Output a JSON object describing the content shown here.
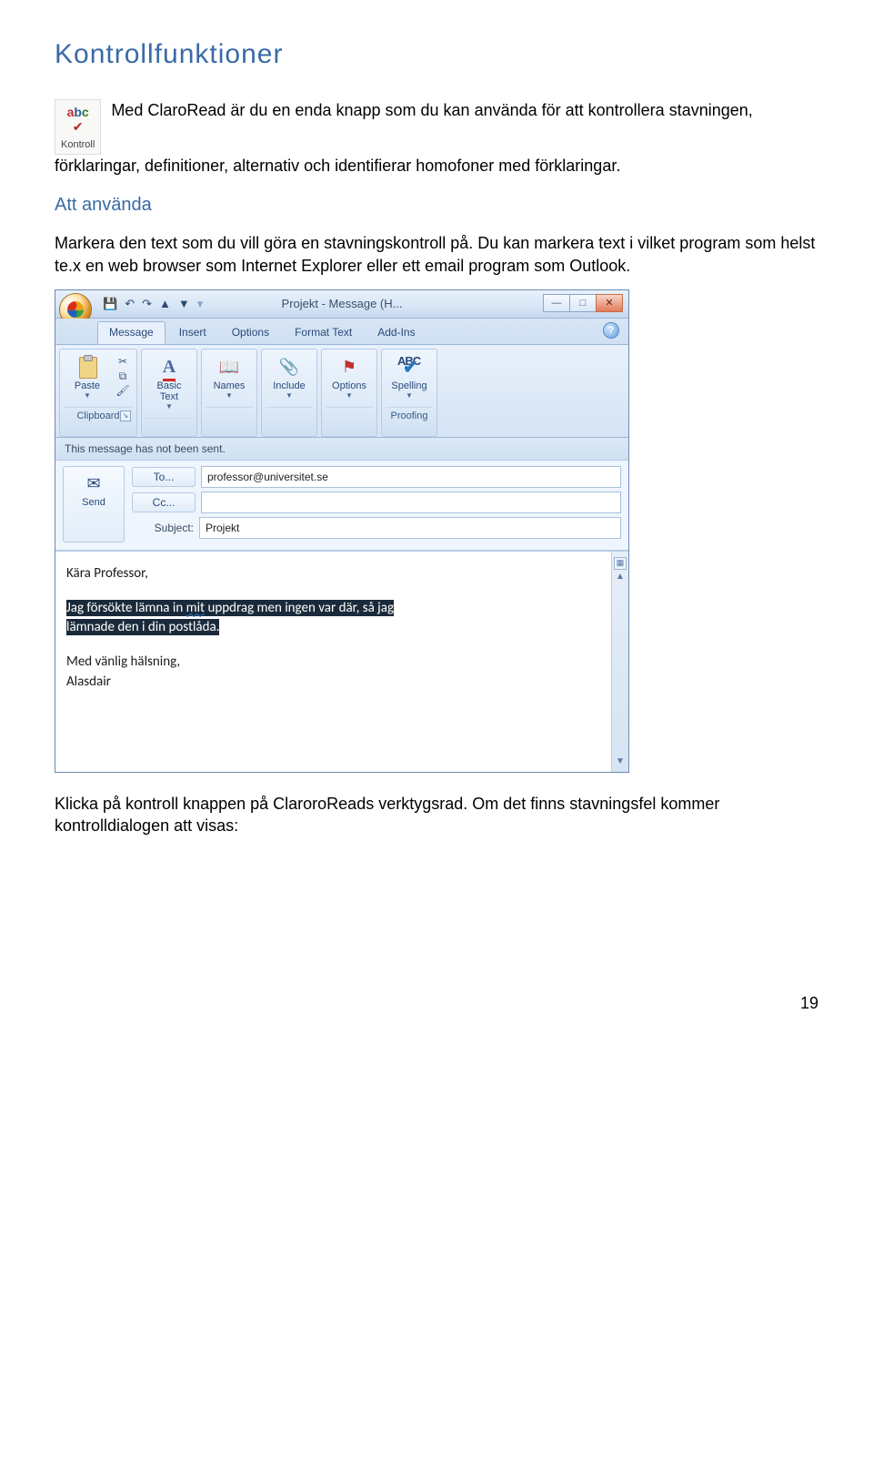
{
  "page": {
    "title": "Kontrollfunktioner",
    "kontroll_icon_label": "Kontroll",
    "intro_text": "Med ClaroRead är du en enda knapp som du kan använda för att kontrollera stavningen, förklaringar, definitioner, alternativ och identifierar homofoner med förklaringar.",
    "sub_heading": "Att använda",
    "para1": "Markera den text som du vill göra en stavningskontroll på. Du kan markera text i vilket program som helst te.x en web browser som Internet Explorer eller ett email program som Outlook.",
    "para2": "Klicka på kontroll knappen på ClaroroReads verktygsrad. Om det finns stavningsfel kommer kontrolldialogen att visas:",
    "page_number": "19"
  },
  "outlook": {
    "qat": {
      "save": "💾",
      "undo": "↶",
      "redo": "↷",
      "up": "▲",
      "down": "▼"
    },
    "window_title": "Projekt - Message (H...",
    "tabs": {
      "message": "Message",
      "insert": "Insert",
      "options": "Options",
      "format_text": "Format Text",
      "addins": "Add-Ins"
    },
    "ribbon": {
      "paste": "Paste",
      "clipboard": "Clipboard",
      "basic_text": "Basic\nText",
      "names": "Names",
      "include": "Include",
      "options": "Options",
      "spelling": "Spelling",
      "proofing": "Proofing",
      "abc": "ABC"
    },
    "infobar": "This message has not been sent.",
    "fields": {
      "send": "Send",
      "to_btn": "To...",
      "to_val": "professor@universitet.se",
      "cc_btn": "Cc...",
      "cc_val": "",
      "subject_lbl": "Subject:",
      "subject_val": "Projekt"
    },
    "body": {
      "greeting": "Kära Professor,",
      "sel_line1_a": "Jag försökte lämna in ",
      "sel_line1_b": "mit",
      "sel_line1_c": " uppdrag men ingen var där, så jag",
      "sel_line2": "lämnade den i din postlåda.",
      "closing": "Med vänlig hälsning,",
      "signature": "Alasdair"
    }
  }
}
